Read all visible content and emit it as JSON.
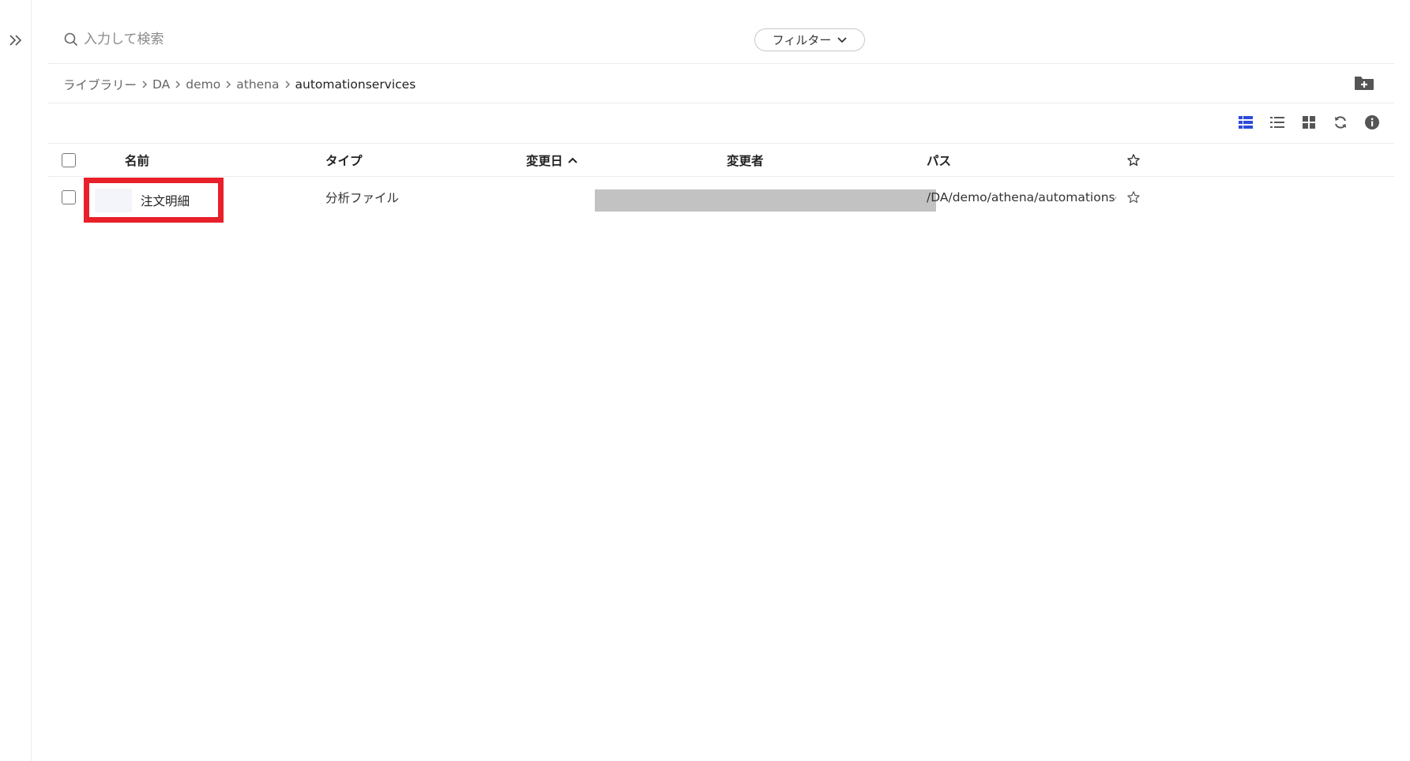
{
  "sidebar": {
    "expand_icon": "double-chevron-right-icon"
  },
  "search": {
    "placeholder": "入力して検索",
    "value": ""
  },
  "filter": {
    "label": "フィルター"
  },
  "breadcrumb": {
    "items": [
      "ライブラリー",
      "DA",
      "demo",
      "athena",
      "automationservices"
    ]
  },
  "toolbar": {
    "icons": [
      "detail-view-icon",
      "list-view-icon",
      "grid-view-icon",
      "refresh-icon",
      "info-icon"
    ],
    "active_color": "#2d4bd8",
    "icon_color": "#555555"
  },
  "table": {
    "columns": {
      "name": "名前",
      "type": "タイプ",
      "modified": "変更日",
      "modified_by": "変更者",
      "path": "パス"
    },
    "rows": [
      {
        "name": "注文明細",
        "type": "分析ファイル",
        "path": "/DA/demo/athena/automationservi..."
      }
    ]
  },
  "colors": {
    "highlight": "#e8202a",
    "redaction": "#c2c2c2"
  }
}
